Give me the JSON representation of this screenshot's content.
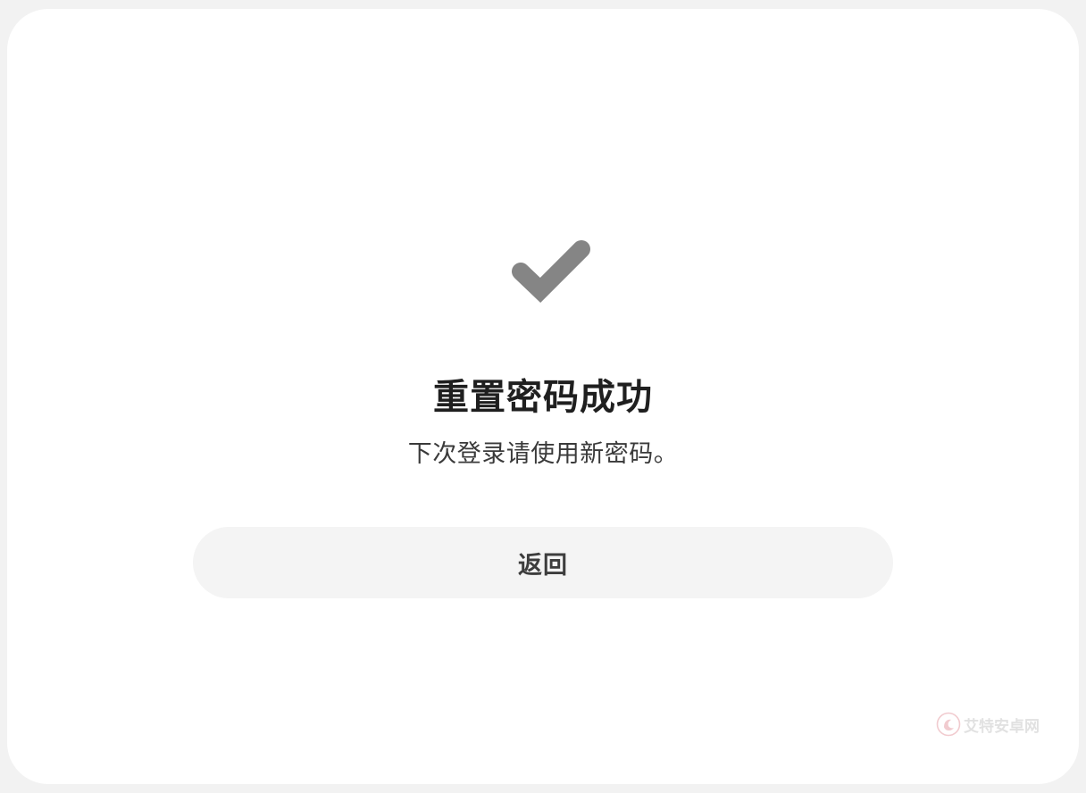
{
  "dialog": {
    "icon": "checkmark-icon",
    "title": "重置密码成功",
    "message": "下次登录请使用新密码。",
    "back_button_label": "返回"
  },
  "watermark": {
    "text": "艾特安卓网",
    "logo_icon": "watermark-logo-icon"
  },
  "colors": {
    "background": "#f2f2f2",
    "card": "#ffffff",
    "icon": "#858585",
    "title": "#1f1f1f",
    "message": "#3a3a3a",
    "button_bg": "#f4f4f4",
    "button_text": "#3d3d3d",
    "watermark_accent": "#e6a1a8"
  }
}
